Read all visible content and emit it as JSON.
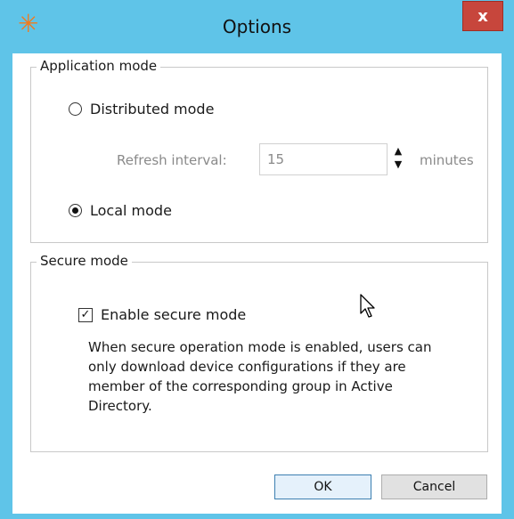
{
  "window": {
    "title": "Options",
    "icon": "asterisk-icon",
    "close_label": "x"
  },
  "application_mode": {
    "legend": "Application mode",
    "distributed_label": "Distributed mode",
    "distributed_selected": false,
    "refresh_label": "Refresh interval:",
    "refresh_value": "15",
    "refresh_units": "minutes",
    "local_label": "Local mode",
    "local_selected": true
  },
  "secure_mode": {
    "legend": "Secure mode",
    "enable_label": "Enable secure mode",
    "enabled": true,
    "description_lines": [
      "When secure operation mode is enabled, users can",
      "only download device configurations if they are",
      "member of the corresponding group in Active",
      "Directory."
    ]
  },
  "buttons": {
    "ok_label": "OK",
    "cancel_label": "Cancel"
  },
  "colors": {
    "titlebar": "#5fc4e8",
    "close_button": "#c7463c",
    "icon": "#f07b1e"
  }
}
